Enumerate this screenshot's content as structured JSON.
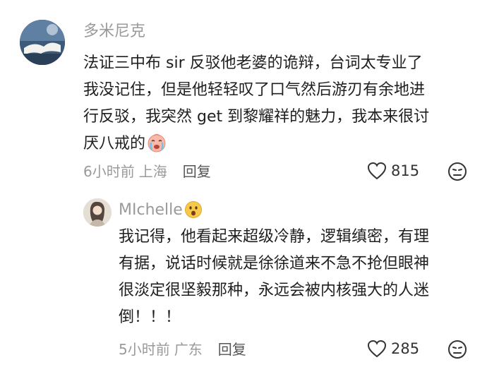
{
  "comment": {
    "author": "多米尼克",
    "lines": [
      "法证三中布 sir 反驳他老婆的诡辩，台词太专业了",
      "我没记住，但是他轻轻叹了口气然后游刃有余地进",
      "行反驳，我突然 get 到黎耀祥的魅力，我本来很讨",
      "厌八戒的"
    ],
    "emoji": "crying-face-emoji",
    "time": "6小时前",
    "location": "上海",
    "reply_label": "回复",
    "likes": "815"
  },
  "reply": {
    "author": "MIchelle",
    "author_emoji": "surprised-face-emoji",
    "lines": [
      "我记得，他看起来超级冷静，逻辑缜密，有理",
      "有据，说话时候就是徐徐道来不急不抢但眼神",
      "很淡定很坚毅那种，永远会被内核强大的人迷",
      "倒！！！"
    ],
    "time": "5小时前",
    "location": "广东",
    "reply_label": "回复",
    "likes": "285"
  },
  "colors": {
    "meta_gray": "#9a9a9a",
    "text": "#1f1f1f",
    "reply_link": "#555555",
    "emoji_yellow": "#f7c948"
  }
}
